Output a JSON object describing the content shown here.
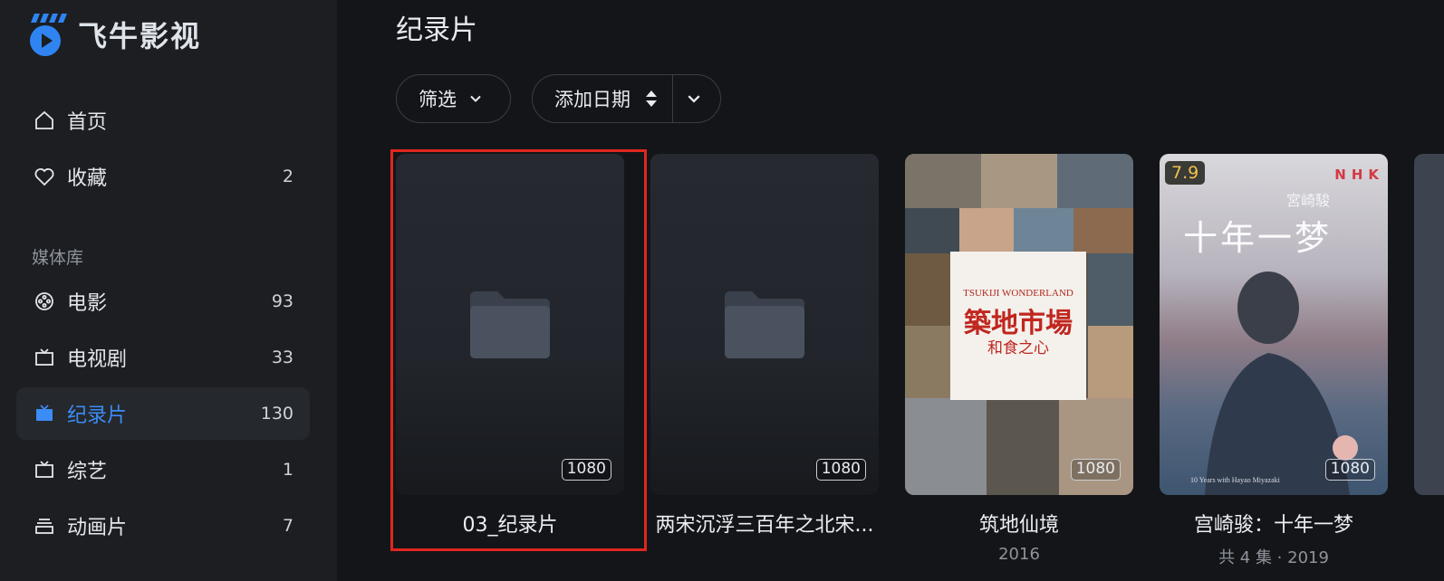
{
  "app": {
    "name": "飞牛影视",
    "accent": "#3b8cf5"
  },
  "sidebar": {
    "home": {
      "label": "首页"
    },
    "favorites": {
      "label": "收藏",
      "count": "2"
    },
    "library_label": "媒体库",
    "items": [
      {
        "label": "电影",
        "count": "93",
        "icon": "film-reel-icon"
      },
      {
        "label": "电视剧",
        "count": "33",
        "icon": "tv-icon"
      },
      {
        "label": "纪录片",
        "count": "130",
        "icon": "tv-filled-icon",
        "active": true
      },
      {
        "label": "综艺",
        "count": "1",
        "icon": "tv-icon"
      },
      {
        "label": "动画片",
        "count": "7",
        "icon": "stack-icon"
      }
    ]
  },
  "main": {
    "title": "纪录片",
    "filter_label": "筛选",
    "sort_label": "添加日期"
  },
  "cards": [
    {
      "title": "03_纪录片",
      "subtitle": "",
      "badge": "1080",
      "kind": "folder"
    },
    {
      "title": "两宋沉浮三百年之北宋...",
      "subtitle": "",
      "badge": "1080",
      "kind": "folder"
    },
    {
      "title": "筑地仙境",
      "subtitle": "2016",
      "badge": "1080",
      "kind": "poster",
      "poster_text": {
        "en": "TSUKIJI WONDERLAND",
        "zh": "築地市場",
        "zh_sub": "和食之心"
      }
    },
    {
      "title": "宫崎骏：十年一梦",
      "subtitle": "共 4 集 · 2019",
      "badge": "1080",
      "kind": "poster",
      "rating": "7.9",
      "poster_text": {
        "top": "宮崎駿",
        "main": "十年一梦",
        "bottom": "10 Years with Hayao Miyazaki",
        "logo": "NHK"
      }
    }
  ]
}
